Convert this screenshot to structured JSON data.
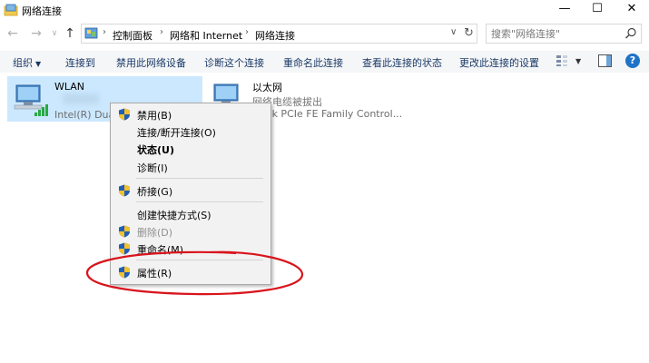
{
  "window": {
    "title": "网络连接",
    "controls": {
      "minimize": "—",
      "maximize": "☐",
      "close": "✕"
    }
  },
  "address_bar": {
    "breadcrumbs": [
      "控制面板",
      "网络和 Internet",
      "网络连接"
    ],
    "search_placeholder": "搜索\"网络连接\""
  },
  "command_bar": {
    "items": [
      "组织",
      "连接到",
      "禁用此网络设备",
      "诊断这个连接",
      "重命名此连接",
      "查看此连接的状态",
      "更改此连接的设置"
    ]
  },
  "connections": [
    {
      "name": "WLAN",
      "status": "",
      "device": "Intel(R) Dual",
      "selected": true
    },
    {
      "name": "以太网",
      "status": "网络电缆被拔出",
      "device": "...tek PCIe FE Family Control..."
    }
  ],
  "context_menu": {
    "items": [
      {
        "label": "禁用(B)",
        "icon": "shield-icon",
        "bold": false,
        "disabled": false
      },
      {
        "label": "连接/断开连接(O)",
        "icon": "",
        "bold": false,
        "disabled": false
      },
      {
        "label": "状态(U)",
        "icon": "",
        "bold": true,
        "disabled": false
      },
      {
        "label": "诊断(I)",
        "icon": "",
        "bold": false,
        "disabled": false
      },
      {
        "label": "桥接(G)",
        "icon": "shield-icon",
        "bold": false,
        "disabled": false
      },
      {
        "label": "创建快捷方式(S)",
        "icon": "",
        "bold": false,
        "disabled": false
      },
      {
        "label": "删除(D)",
        "icon": "shield-icon",
        "bold": false,
        "disabled": true
      },
      {
        "label": "重命名(M)",
        "icon": "shield-icon",
        "bold": false,
        "disabled": false
      },
      {
        "label": "属性(R)",
        "icon": "shield-icon",
        "bold": false,
        "disabled": false
      }
    ]
  },
  "colors": {
    "selection": "#cce8ff",
    "command_text": "#1a3a68",
    "annotation": "#d9141c",
    "help": "#1e73c8"
  }
}
